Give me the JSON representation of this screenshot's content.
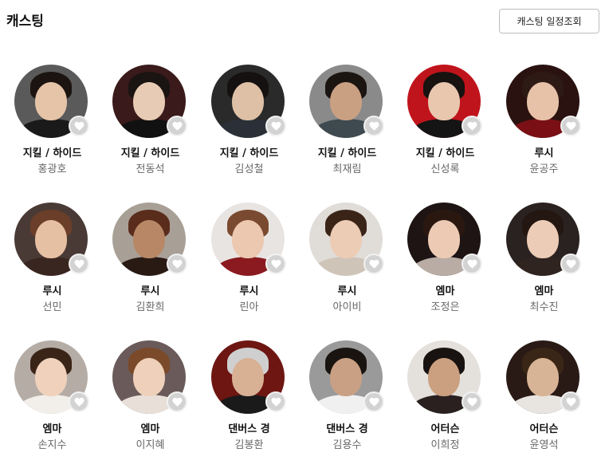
{
  "section": {
    "title": "캐스팅",
    "schedule_button": "캐스팅 일정조회"
  },
  "cast": [
    {
      "role": "지킬 / 하이드",
      "name": "홍광호",
      "bg": "#5a5a5a",
      "skin": "#e6c4a8",
      "hair": "#1c1410",
      "cloth": "#1a1a1a"
    },
    {
      "role": "지킬 / 하이드",
      "name": "전동석",
      "bg": "#3a1a1a",
      "skin": "#e8cbb4",
      "hair": "#1a1412",
      "cloth": "#111111"
    },
    {
      "role": "지킬 / 하이드",
      "name": "김성철",
      "bg": "#2a2a2a",
      "skin": "#ddc0a6",
      "hair": "#151110",
      "cloth": "#2b3038"
    },
    {
      "role": "지킬 / 하이드",
      "name": "최재림",
      "bg": "#8a8a8a",
      "skin": "#caa083",
      "hair": "#1b1512",
      "cloth": "#3e4a4f"
    },
    {
      "role": "지킬 / 하이드",
      "name": "신성록",
      "bg": "#c0141c",
      "skin": "#e9c7ae",
      "hair": "#181210",
      "cloth": "#141414"
    },
    {
      "role": "루시",
      "name": "윤공주",
      "bg": "#2a1210",
      "skin": "#e7c2a8",
      "hair": "#2e1a14",
      "cloth": "#7a1016"
    },
    {
      "role": "루시",
      "name": "선민",
      "bg": "#4a3a36",
      "skin": "#e6c0a2",
      "hair": "#6a3e28",
      "cloth": "#3a2620"
    },
    {
      "role": "루시",
      "name": "김환희",
      "bg": "#a8a096",
      "skin": "#b88866",
      "hair": "#5a2c1c",
      "cloth": "#2a1a14"
    },
    {
      "role": "루시",
      "name": "린아",
      "bg": "#e8e4e2",
      "skin": "#ecc8b0",
      "hair": "#7a4a30",
      "cloth": "#8a1a20"
    },
    {
      "role": "루시",
      "name": "아이비",
      "bg": "#e0dcd8",
      "skin": "#ecccb4",
      "hair": "#3a2418",
      "cloth": "#cfc4b8"
    },
    {
      "role": "엠마",
      "name": "조정은",
      "bg": "#1e1414",
      "skin": "#eccab4",
      "hair": "#2a1810",
      "cloth": "#b8aca4"
    },
    {
      "role": "엠마",
      "name": "최수진",
      "bg": "#2a2220",
      "skin": "#ecccb6",
      "hair": "#241610",
      "cloth": "#302420"
    },
    {
      "role": "엠마",
      "name": "손지수",
      "bg": "#b5aca6",
      "skin": "#f0d2bc",
      "hair": "#3a2418",
      "cloth": "#f2eeea"
    },
    {
      "role": "엠마",
      "name": "이지혜",
      "bg": "#6a5a5a",
      "skin": "#efd0ba",
      "hair": "#7a4a2a",
      "cloth": "#e8e0d8"
    },
    {
      "role": "댄버스 경",
      "name": "김봉환",
      "bg": "#6e1612",
      "skin": "#d8b094",
      "hair": "#cfcfcf",
      "cloth": "#1a1a1a"
    },
    {
      "role": "댄버스 경",
      "name": "김용수",
      "bg": "#9a9a9a",
      "skin": "#caa084",
      "hair": "#1a1410",
      "cloth": "#f0f0f0"
    },
    {
      "role": "어터슨",
      "name": "이희정",
      "bg": "#e4e0dc",
      "skin": "#caa080",
      "hair": "#181210",
      "cloth": "#2a2020"
    },
    {
      "role": "어터슨",
      "name": "윤영석",
      "bg": "#2a1a16",
      "skin": "#d8b496",
      "hair": "#3a2616",
      "cloth": "#e8e4e0"
    }
  ]
}
